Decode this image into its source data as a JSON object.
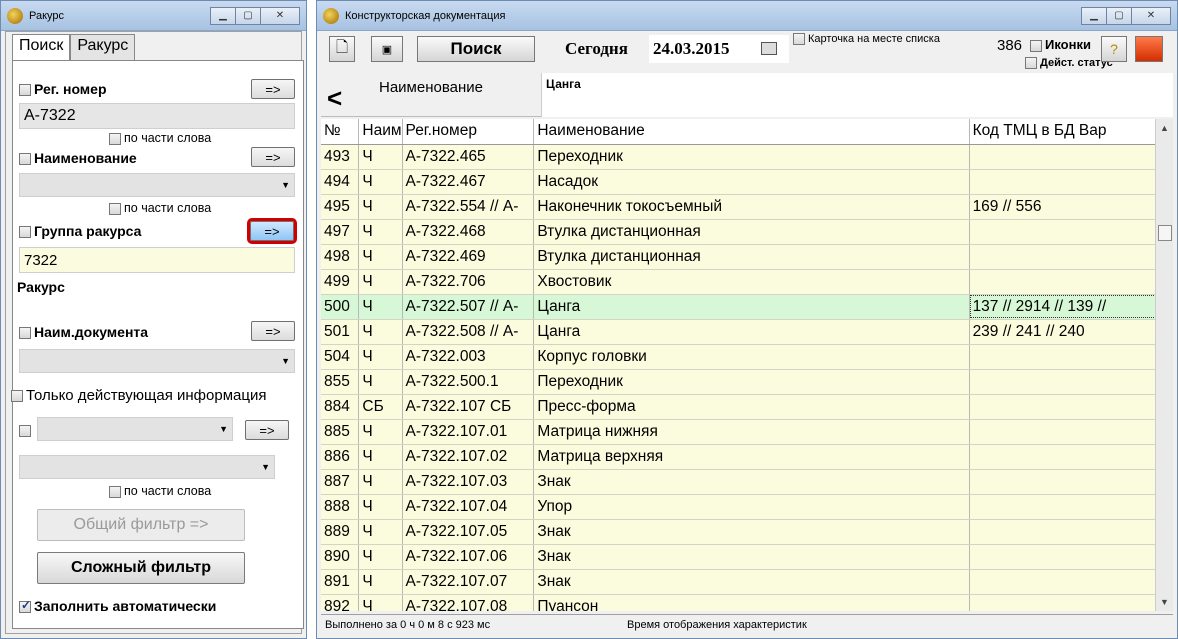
{
  "left_window": {
    "title": "Ракурс",
    "tabs": [
      "Поиск",
      "Ракурс"
    ],
    "reg_number": {
      "label": "Рег. номер",
      "value": "А-7322",
      "partial_label": "по части слова",
      "button": "=>"
    },
    "name": {
      "label": "Наименование",
      "value": "",
      "partial_label": "по части слова",
      "button": "=>"
    },
    "group": {
      "label": "Группа ракурса",
      "value": "7322",
      "button": "=>"
    },
    "rakurs_label": "Ракурс",
    "doc_name": {
      "label": "Наим.документа",
      "value": "",
      "button": "=>"
    },
    "only_active": {
      "label": "Только действующая информация"
    },
    "extra": {
      "button": "=>",
      "partial_label": "по части слова"
    },
    "general_filter": "Общий фильтр  =>",
    "complex_filter": "Сложный фильтр",
    "autofill": "Заполнить автоматически"
  },
  "right_window": {
    "title": "Конструкторская документация",
    "toolbar": {
      "search": "Поиск",
      "today_label": "Сегодня",
      "date": "24.03.2015",
      "card_in_place": "Карточка на месте списка",
      "count": "386",
      "icons_label": "Иконки",
      "active_status": "Дейст. статус"
    },
    "name_header": {
      "back": "<",
      "label": "Наименование",
      "value": "Цанга"
    },
    "table": {
      "columns": [
        "№",
        "Наим",
        "Рег.номер",
        "Наименование",
        "Код ТМЦ в БД Вар"
      ],
      "rows": [
        [
          "493",
          "Ч",
          "А-7322.465",
          "Переходник",
          ""
        ],
        [
          "494",
          "Ч",
          "А-7322.467",
          "Насадок",
          ""
        ],
        [
          "495",
          "Ч",
          "А-7322.554 // А-",
          "Наконечник токосъемный",
          "169 // 556"
        ],
        [
          "497",
          "Ч",
          "А-7322.468",
          "Втулка дистанционная",
          ""
        ],
        [
          "498",
          "Ч",
          "А-7322.469",
          "Втулка дистанционная",
          ""
        ],
        [
          "499",
          "Ч",
          "А-7322.706",
          "Хвостовик",
          ""
        ],
        [
          "500",
          "Ч",
          "А-7322.507 // А-",
          "Цанга",
          "137 // 2914 // 139 //"
        ],
        [
          "501",
          "Ч",
          "А-7322.508 // А-",
          "Цанга",
          "239 // 241 // 240"
        ],
        [
          "504",
          "Ч",
          "А-7322.003",
          "Корпус головки",
          ""
        ],
        [
          "855",
          "Ч",
          "А-7322.500.1",
          "Переходник",
          ""
        ],
        [
          "884",
          "СБ",
          "А-7322.107 СБ",
          "Пресс-форма",
          ""
        ],
        [
          "885",
          "Ч",
          "А-7322.107.01",
          "Матрица нижняя",
          ""
        ],
        [
          "886",
          "Ч",
          "А-7322.107.02",
          "Матрица верхняя",
          ""
        ],
        [
          "887",
          "Ч",
          "А-7322.107.03",
          "Знак",
          ""
        ],
        [
          "888",
          "Ч",
          "А-7322.107.04",
          "Упор",
          ""
        ],
        [
          "889",
          "Ч",
          "А-7322.107.05",
          "Знак",
          ""
        ],
        [
          "890",
          "Ч",
          "А-7322.107.06",
          "Знак",
          ""
        ],
        [
          "891",
          "Ч",
          "А-7322.107.07",
          "Знак",
          ""
        ],
        [
          "892",
          "Ч",
          "А-7322.107.08",
          "Пуансон",
          ""
        ]
      ],
      "selected_row": 6
    },
    "status": {
      "elapsed": "Выполнено за 0 ч 0 м 8 с 923 мс",
      "message": "Время отображения характеристик"
    }
  }
}
